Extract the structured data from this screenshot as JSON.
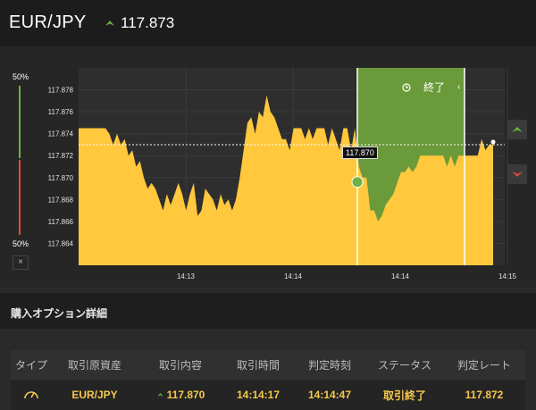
{
  "header": {
    "pair": "EUR/JPY",
    "rate": "117.873",
    "trend": "up"
  },
  "chart": {
    "gauge_top_label": "50%",
    "gauge_bottom_label": "50%",
    "gauge_collapse": "×",
    "y_ticks": [
      "117.878",
      "117.876",
      "117.874",
      "117.872",
      "117.870",
      "117.868",
      "117.866",
      "117.864"
    ],
    "x_ticks": [
      "14:13",
      "14:14",
      "14:14",
      "14:15"
    ],
    "end_label": "終了",
    "entry_price": "117.870",
    "colors": {
      "area": "#ffc83d",
      "win_zone": "#6a9a3a",
      "call": "#6db33f",
      "put": "#e0493a"
    }
  },
  "chart_data": {
    "type": "area",
    "title": "",
    "xlabel": "",
    "ylabel": "",
    "ylim": [
      117.862,
      117.88
    ],
    "x_tick_labels": [
      "14:13",
      "14:14",
      "14:14",
      "14:15"
    ],
    "series": [
      {
        "values": [
          117.8745,
          117.8745,
          117.8745,
          117.8745,
          117.8745,
          117.8745,
          117.8745,
          117.8745,
          117.874,
          117.873,
          117.874,
          117.873,
          117.8735,
          117.872,
          117.8725,
          117.871,
          117.8715,
          117.87,
          117.869,
          117.8695,
          117.869,
          117.868,
          117.867,
          117.8685,
          117.8675,
          117.8685,
          117.8695,
          117.8685,
          117.867,
          117.8685,
          117.8695,
          117.8665,
          117.867,
          117.869,
          117.8685,
          117.868,
          117.867,
          117.8685,
          117.8675,
          117.868,
          117.867,
          117.868,
          117.87,
          117.8725,
          117.875,
          117.8755,
          117.874,
          117.876,
          117.8755,
          117.8775,
          117.876,
          117.8755,
          117.8745,
          117.8735,
          117.8735,
          117.8725,
          117.8745,
          117.8745,
          117.8745,
          117.8735,
          117.8745,
          117.8735,
          117.8745,
          117.8745,
          117.8745,
          117.873,
          117.8745,
          117.8735,
          117.8725,
          117.8745,
          117.8745,
          117.8725,
          117.8745,
          117.871,
          117.87,
          117.87,
          117.867,
          117.867,
          117.866,
          117.8665,
          117.8675,
          117.868,
          117.8685,
          117.8695,
          117.8705,
          117.8705,
          117.871,
          117.8705,
          117.871,
          117.872,
          117.872,
          117.872,
          117.872,
          117.872,
          117.872,
          117.872,
          117.871,
          117.872,
          117.871,
          117.872,
          117.872,
          117.872,
          117.872,
          117.872,
          117.872,
          117.8735,
          117.8725,
          117.873,
          117.873
        ]
      }
    ],
    "entry_value": 117.87,
    "current_value": 117.873
  },
  "section": {
    "title": "購入オプション詳細"
  },
  "table": {
    "headers": [
      "タイプ",
      "取引原資産",
      "取引内容",
      "取引時間",
      "判定時刻",
      "ステータス",
      "判定レート"
    ],
    "row": {
      "asset": "EUR/JPY",
      "content": "117.870",
      "trade_time": "14:14:17",
      "judge_time": "14:14:47",
      "status": "取引終了",
      "judge_rate": "117.872"
    }
  }
}
